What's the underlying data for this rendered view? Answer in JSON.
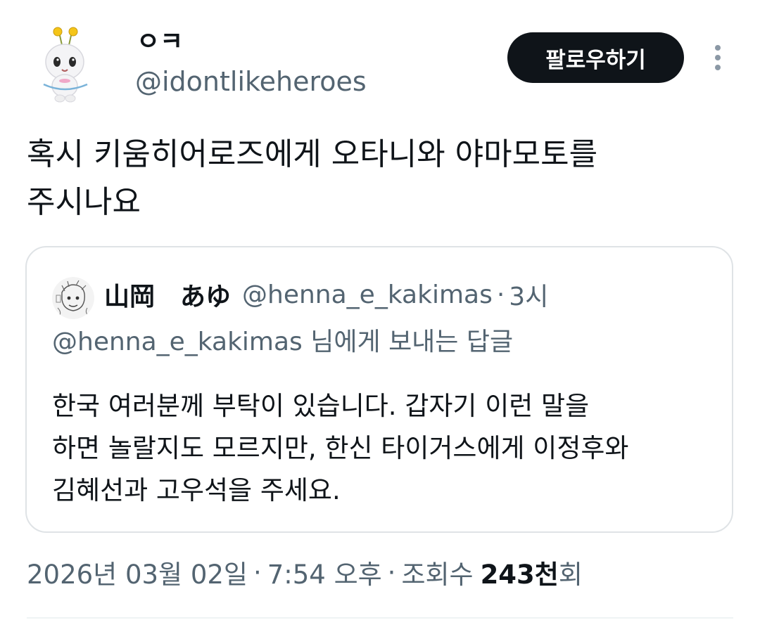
{
  "tweet": {
    "author": {
      "display_name": "ㅇㅋ",
      "handle": "@idontlikeheroes"
    },
    "follow_label": "팔로우하기",
    "text": "혹시 키움히어로즈에게 오타니와 야마모토를\n주시나요",
    "timestamp": {
      "date": "2026년 03월 02일",
      "time": "7:54 오후",
      "views_label": "조회수",
      "views_count": "243천",
      "views_suffix": "회"
    }
  },
  "quote": {
    "display_name": "山岡　あゆ",
    "handle": "@henna_e_kakimas",
    "time": "3시",
    "reply_context": "@henna_e_kakimas 님에게 보내는 답글",
    "text": "한국 여러분께 부탁이 있습니다. 갑자기 이런 말을\n하면 놀랄지도 모르지만, 한신 타이거스에게 이정후와\n김혜선과 고우석을 주세요."
  },
  "colors": {
    "text_primary": "#0f1419",
    "text_secondary": "#536471",
    "follow_bg": "#0f1419",
    "border": "#dfe3e6"
  },
  "icons": {
    "more": "more-vertical-icon",
    "avatar": "ghost-character-avatar",
    "quote_avatar": "sketch-portrait-avatar"
  },
  "separators": {
    "dot": "·"
  }
}
